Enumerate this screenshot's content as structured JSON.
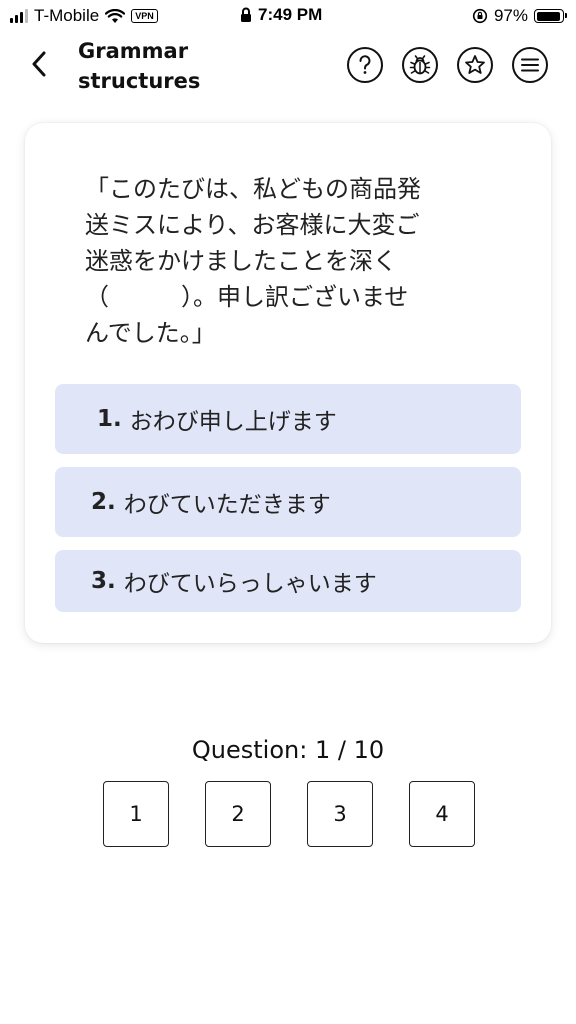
{
  "status_bar": {
    "carrier": "T-Mobile",
    "vpn_label": "VPN",
    "time": "7:49 PM",
    "battery_percent": "97%",
    "battery_level": 0.97,
    "icons": [
      "signal-icon",
      "wifi-icon",
      "lock-icon",
      "orientation-lock-icon",
      "battery-icon"
    ]
  },
  "header": {
    "title": "Grammar\nstructures",
    "icons": [
      "back-chevron-icon",
      "help-icon",
      "bug-icon",
      "star-icon",
      "menu-icon"
    ]
  },
  "question": {
    "text": "「このたびは、私どもの商品発\n送ミスにより、お客様に大変ご\n迷惑をかけましたことを深く\n（　　　）。申し訳ございませ\nんでした。」"
  },
  "options": [
    {
      "number": "1.",
      "label": "おわび申し上げます"
    },
    {
      "number": "2.",
      "label": "わびていただきます"
    },
    {
      "number": "3.",
      "label": "わびていらっしゃいます"
    }
  ],
  "footer": {
    "counter": "Question: 1 / 10",
    "pages": [
      "1",
      "2",
      "3",
      "4"
    ]
  },
  "colors": {
    "option_background": "#e0e6f8",
    "text": "#111111"
  }
}
